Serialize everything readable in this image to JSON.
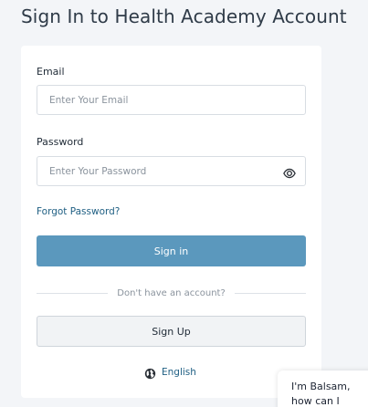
{
  "page": {
    "title": "Sign In to Health Academy Account"
  },
  "form": {
    "email": {
      "label": "Email",
      "placeholder": "Enter Your Email",
      "value": ""
    },
    "password": {
      "label": "Password",
      "placeholder": "Enter Your Password",
      "value": "",
      "toggle_icon": "eye-icon"
    },
    "forgot_link": "Forgot Password?",
    "signin_label": "Sign in",
    "divider_text": "Don't have an account?",
    "signup_label": "Sign Up"
  },
  "language": {
    "icon": "globe-icon",
    "label": "English"
  },
  "chat": {
    "line1": "I'm Balsam,",
    "line2": "how can I"
  },
  "colors": {
    "primary_button": "#5b98bd",
    "link": "#1f5f83",
    "background": "#f3f5f8"
  }
}
